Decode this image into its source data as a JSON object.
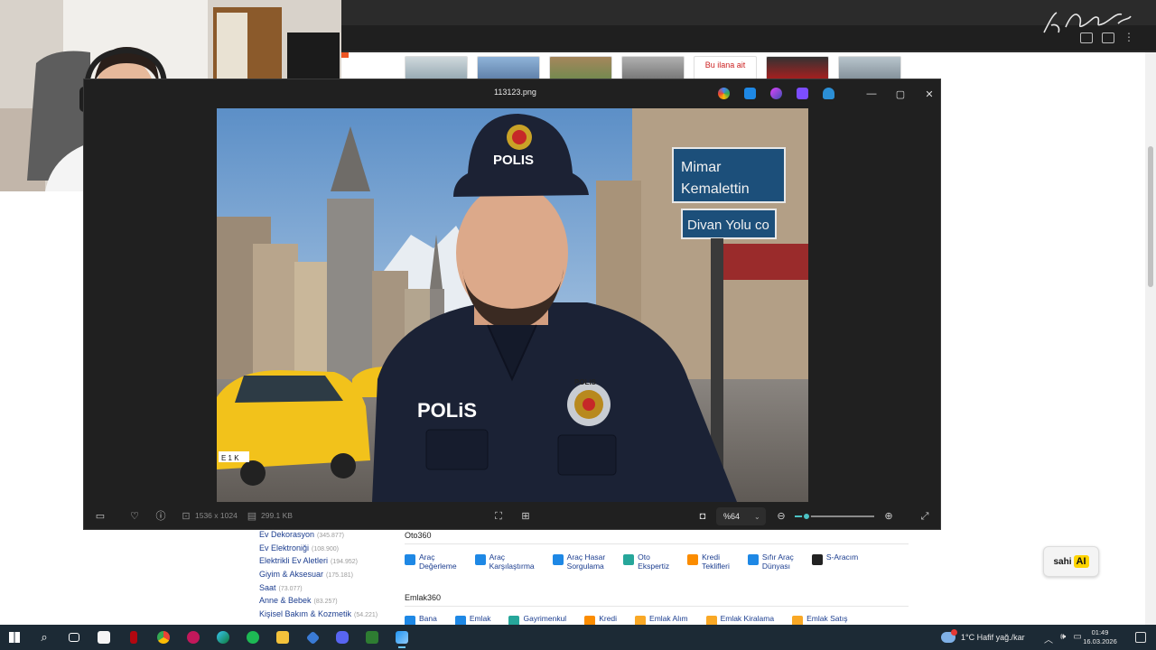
{
  "browser": {
    "listing_thumb_text": "Bu ilana ait"
  },
  "categories": [
    {
      "label": "Ev Dekorasyon",
      "count": "(345.877)"
    },
    {
      "label": "Ev Elektroniği",
      "count": "(108.900)"
    },
    {
      "label": "Elektrikli Ev Aletleri",
      "count": "(194.952)"
    },
    {
      "label": "Giyim & Aksesuar",
      "count": "(175.181)"
    },
    {
      "label": "Saat",
      "count": "(73.077)"
    },
    {
      "label": "Anne & Bebek",
      "count": "(83.257)"
    },
    {
      "label": "Kişisel Bakım & Kozmetik",
      "count": "(54.221)"
    }
  ],
  "oto360": {
    "title": "Oto360",
    "items": [
      {
        "label": "Araç\nDeğerleme",
        "icon": "chart-icon",
        "color": "#1e88e5"
      },
      {
        "label": "Araç\nKarşılaştırma",
        "icon": "swap-icon",
        "color": "#1e88e5"
      },
      {
        "label": "Araç Hasar\nSorgulama",
        "icon": "wrench-icon",
        "color": "#1e88e5"
      },
      {
        "label": "Oto\nEkspertiz",
        "icon": "search-doc-icon",
        "color": "#26a69a"
      },
      {
        "label": "Kredi\nTeklifleri",
        "icon": "percent-icon",
        "color": "#fb8c00"
      },
      {
        "label": "Sıfır Araç\nDünyası",
        "icon": "sparkle-icon",
        "color": "#1e88e5"
      },
      {
        "label": "S-Aracım",
        "icon": "car-icon",
        "color": "#222222"
      }
    ]
  },
  "emlak360": {
    "title": "Emlak360",
    "items": [
      {
        "label": "Bana",
        "icon": "pin-icon",
        "color": "#1e88e5"
      },
      {
        "label": "Emlak",
        "icon": "chart-icon",
        "color": "#1e88e5"
      },
      {
        "label": "Gayrimenkul",
        "icon": "building-icon",
        "color": "#26a69a"
      },
      {
        "label": "Kredi",
        "icon": "percent-icon",
        "color": "#fb8c00"
      },
      {
        "label": "Emlak Alım",
        "icon": "bars-icon",
        "color": "#f9a825"
      },
      {
        "label": "Emlak Kiralama",
        "icon": "bars-icon",
        "color": "#f9a825"
      },
      {
        "label": "Emlak Satış",
        "icon": "bars-icon",
        "color": "#f9a825"
      }
    ]
  },
  "sahi": {
    "label": "sahi",
    "ai": "AI"
  },
  "viewer": {
    "title": "113123.png",
    "dimensions": "1536 x 1024",
    "file_size": "299.1 KB",
    "zoom": "%64",
    "zoom_level": 0.15
  },
  "photo": {
    "cap_text": "POLIS",
    "badge_text": "POLIS",
    "chest_text": "POLiS",
    "sign1_line1": "Mimar",
    "sign1_line2": "Kemalettin",
    "sign2": "Divan Yolu co",
    "plate": "E 1 K"
  },
  "taskbar": {
    "weather": "1°C  Hafif yağ./kar",
    "time": "01:49",
    "date": "16.03.2026"
  }
}
